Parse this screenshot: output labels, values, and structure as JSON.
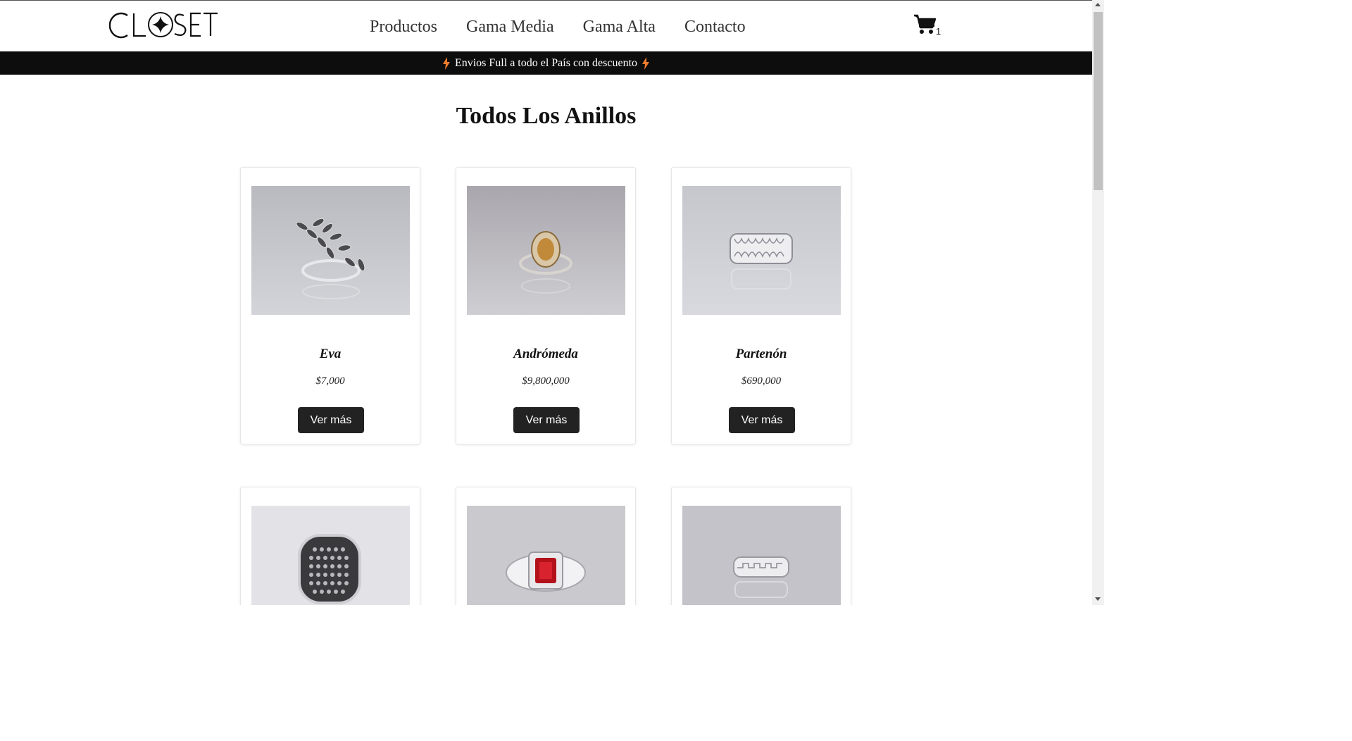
{
  "brand": {
    "logo_text": "CLOSET"
  },
  "nav": {
    "items": [
      {
        "label": "Productos"
      },
      {
        "label": "Gama Media"
      },
      {
        "label": "Gama Alta"
      },
      {
        "label": "Contacto"
      }
    ]
  },
  "cart": {
    "count": "1",
    "icon": "cart-icon"
  },
  "promo": {
    "text": "Envios Full a todo el País con descuento",
    "icon": "lightning-icon",
    "icon_color": "#f07c2e"
  },
  "page": {
    "title": "Todos Los Anillos"
  },
  "products": [
    {
      "name": "Eva",
      "price": "$7,000",
      "button": "Ver más"
    },
    {
      "name": "Andrómeda",
      "price": "$9,800,000",
      "button": "Ver más"
    },
    {
      "name": "Partenón",
      "price": "$690,000",
      "button": "Ver más"
    },
    {
      "name": "",
      "price": "",
      "button": ""
    },
    {
      "name": "",
      "price": "",
      "button": ""
    },
    {
      "name": "",
      "price": "",
      "button": ""
    }
  ],
  "colors": {
    "promo_bg": "#0d0d0d",
    "button_bg": "#222222",
    "card_image_bg": "#c4c4ca"
  }
}
